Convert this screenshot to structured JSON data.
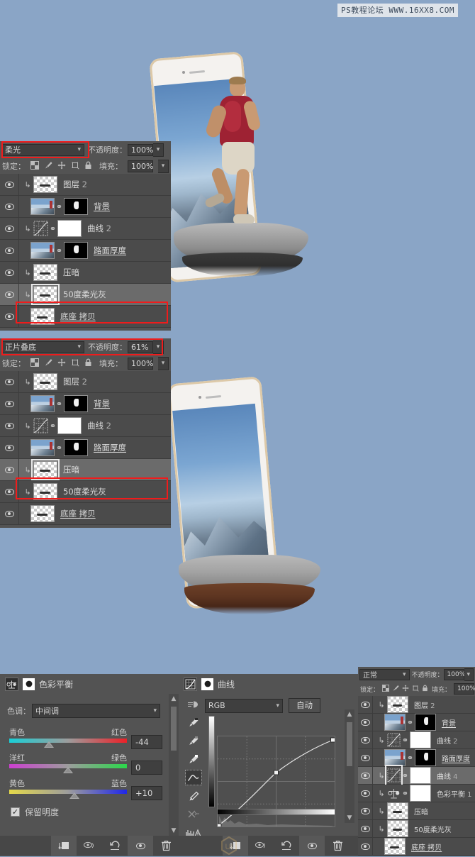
{
  "watermark": "PS教程论坛 WWW.16XX8.COM",
  "colors": {
    "canvas_bg": "#8aa5c6",
    "panel_bg": "#535353",
    "layer_bg": "#4b4b4b",
    "selection": "#6b6b6b",
    "highlight_box": "#ef1c1c"
  },
  "layers_panel_top": {
    "blend_mode": "柔光",
    "opacity_label": "不透明度：",
    "opacity_value": "100%",
    "lock_label": "锁定：",
    "fill_label": "填充：",
    "fill_value": "100%",
    "lock_icons": [
      "transparent-pixels-icon",
      "brush-icon",
      "move-icon",
      "artboard-icon",
      "lock-icon"
    ],
    "rows": [
      {
        "name": "图层",
        "suffix": "2",
        "clipped": true,
        "thumb": "transparent",
        "mask": null,
        "selected": false,
        "underline": false
      },
      {
        "name": "背景",
        "suffix": "",
        "clipped": false,
        "thumb": "photo",
        "mask": "black",
        "selected": false,
        "underline": true
      },
      {
        "name": "曲线",
        "suffix": "2",
        "clipped": true,
        "thumb": "curve",
        "mask": "white",
        "selected": false,
        "underline": false
      },
      {
        "name": "路面厚度",
        "suffix": "",
        "clipped": false,
        "thumb": "photo",
        "mask": "black",
        "selected": false,
        "underline": true
      },
      {
        "name": "压暗",
        "suffix": "",
        "clipped": true,
        "thumb": "transparent",
        "mask": null,
        "selected": false,
        "underline": false
      },
      {
        "name": "50度柔光灰",
        "suffix": "",
        "clipped": true,
        "thumb": "transparent",
        "mask": null,
        "selected": true,
        "underline": false
      },
      {
        "name": "底座 拷贝",
        "suffix": "",
        "clipped": false,
        "thumb": "transparent",
        "mask": null,
        "selected": false,
        "underline": true
      }
    ],
    "highlighted_row_index": 5
  },
  "layers_panel_mid": {
    "blend_mode": "正片叠底",
    "opacity_label": "不透明度：",
    "opacity_value": "61%",
    "lock_label": "锁定：",
    "fill_label": "填充：",
    "fill_value": "100%",
    "rows": [
      {
        "name": "图层",
        "suffix": "2",
        "clipped": true,
        "thumb": "transparent",
        "mask": null,
        "selected": false,
        "underline": false
      },
      {
        "name": "背景",
        "suffix": "",
        "clipped": false,
        "thumb": "photo",
        "mask": "black",
        "selected": false,
        "underline": true
      },
      {
        "name": "曲线",
        "suffix": "2",
        "clipped": true,
        "thumb": "curve",
        "mask": "white",
        "selected": false,
        "underline": false
      },
      {
        "name": "路面厚度",
        "suffix": "",
        "clipped": false,
        "thumb": "photo",
        "mask": "black",
        "selected": false,
        "underline": true
      },
      {
        "name": "压暗",
        "suffix": "",
        "clipped": true,
        "thumb": "transparent",
        "mask": null,
        "selected": true,
        "underline": false
      },
      {
        "name": "50度柔光灰",
        "suffix": "",
        "clipped": true,
        "thumb": "transparent",
        "mask": null,
        "selected": false,
        "underline": false
      },
      {
        "name": "底座 拷贝",
        "suffix": "",
        "clipped": false,
        "thumb": "transparent",
        "mask": null,
        "selected": false,
        "underline": true
      }
    ],
    "highlighted_row_index": 4
  },
  "color_balance": {
    "title": "色彩平衡",
    "tone_label": "色调：",
    "tone_value": "中间调",
    "sliders": [
      {
        "left": "青色",
        "right": "红色",
        "value": "-44",
        "pos": 0.34
      },
      {
        "left": "洋红",
        "right": "绿色",
        "value": "0",
        "pos": 0.5
      },
      {
        "left": "黄色",
        "right": "蓝色",
        "value": "+10",
        "pos": 0.56
      }
    ],
    "preserve_luminosity_label": "保留明度",
    "preserve_luminosity_checked": true,
    "footer_icons": [
      "clip-to-layer-icon",
      "toggle-previous-icon",
      "reset-icon",
      "visibility-icon",
      "delete-icon"
    ]
  },
  "curves": {
    "title": "曲线",
    "channel": "RGB",
    "auto_label": "自动",
    "tools": [
      "preset-icon",
      "black-point-eyedropper-icon",
      "gray-point-eyedropper-icon",
      "white-point-eyedropper-icon",
      "curve-point-tool-icon",
      "pencil-tool-icon",
      "smooth-curve-icon",
      "histogram-warning-icon"
    ],
    "active_tool_index": 4,
    "points": [
      {
        "x": 0.0,
        "y": 0.0
      },
      {
        "x": 0.53,
        "y": 0.6
      },
      {
        "x": 1.0,
        "y": 0.93
      }
    ],
    "footer_icons": [
      "clip-to-layer-icon",
      "toggle-previous-icon",
      "reset-icon",
      "visibility-icon",
      "delete-icon"
    ]
  },
  "layers_panel_right": {
    "blend_mode": "正常",
    "opacity_label": "不透明度：",
    "opacity_value": "100%",
    "lock_label": "锁定：",
    "fill_label": "填充：",
    "fill_value": "100%",
    "rows": [
      {
        "name": "图层",
        "suffix": "2",
        "clipped": true,
        "thumb": "transparent",
        "mask": null,
        "selected": false,
        "underline": false
      },
      {
        "name": "背景",
        "suffix": "",
        "clipped": false,
        "thumb": "photo",
        "mask": "black",
        "selected": false,
        "underline": true
      },
      {
        "name": "曲线",
        "suffix": "2",
        "clipped": true,
        "thumb": "curve",
        "mask": "white",
        "selected": false,
        "underline": false
      },
      {
        "name": "路面厚度",
        "suffix": "",
        "clipped": false,
        "thumb": "photo",
        "mask": "black",
        "selected": false,
        "underline": true
      },
      {
        "name": "曲线",
        "suffix": "4",
        "clipped": true,
        "thumb": "curve",
        "mask": "white",
        "selected": true,
        "underline": false
      },
      {
        "name": "色彩平衡",
        "suffix": "1",
        "clipped": true,
        "thumb": "balance",
        "mask": "white",
        "selected": false,
        "underline": false
      },
      {
        "name": "压暗",
        "suffix": "",
        "clipped": true,
        "thumb": "transparent",
        "mask": null,
        "selected": false,
        "underline": false
      },
      {
        "name": "50度柔光灰",
        "suffix": "",
        "clipped": true,
        "thumb": "transparent",
        "mask": null,
        "selected": false,
        "underline": false
      },
      {
        "name": "底座 拷贝",
        "suffix": "",
        "clipped": false,
        "thumb": "transparent",
        "mask": null,
        "selected": false,
        "underline": true
      }
    ]
  },
  "artwork": {
    "top": {
      "description": "phone-with-runner-on-grey-rock",
      "rock_color": "#8d8d8d",
      "shadow_color": "#3a3a3a"
    },
    "bottom": {
      "description": "phone-with-runner-on-brown-rock",
      "rock_color": "#8d8d8d",
      "underside_color": "#6b3f2a"
    }
  }
}
